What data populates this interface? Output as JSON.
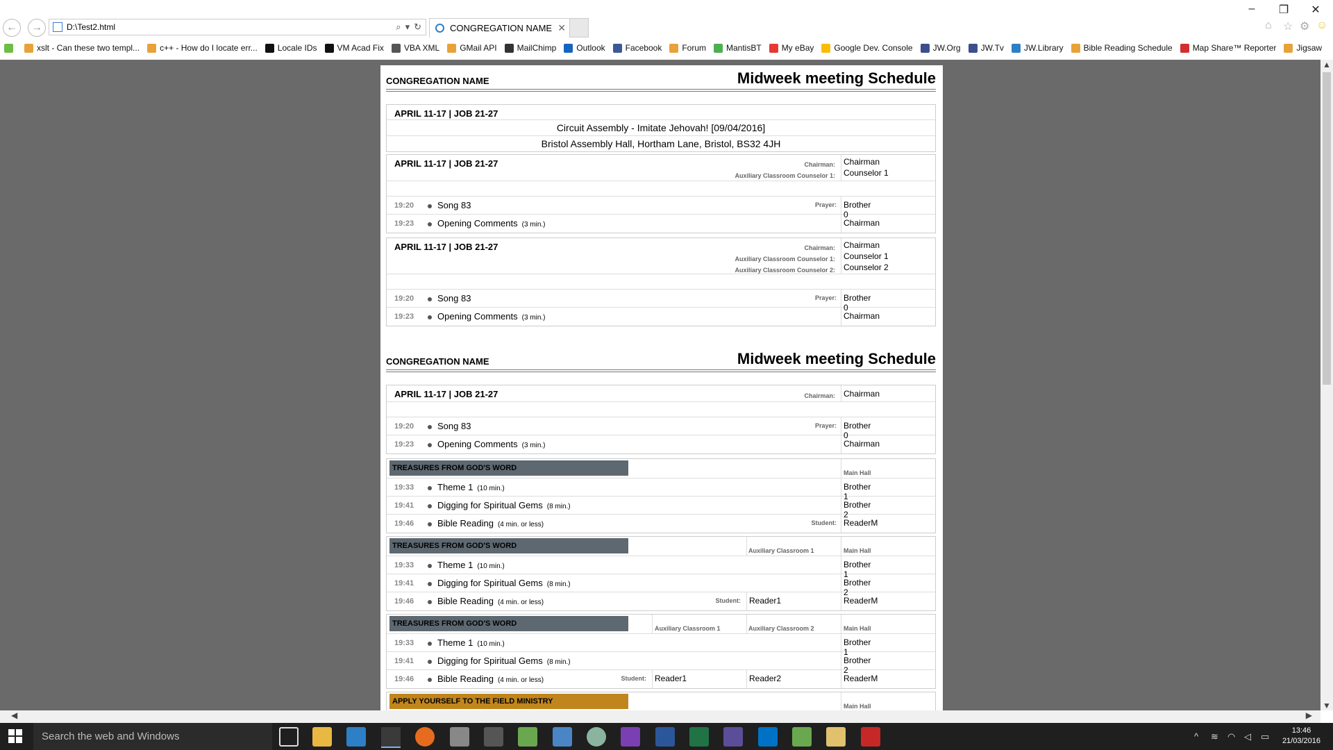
{
  "browser": {
    "address": "D:\\Test2.html",
    "tab_title": "CONGREGATION NAME",
    "tab_close": "✕",
    "favorites": [
      {
        "label": "xslt - Can these two templ...",
        "color": "#e8a23a"
      },
      {
        "label": "c++ - How do I locate err...",
        "color": "#e8a23a"
      },
      {
        "label": "Locale IDs",
        "color": "#111111"
      },
      {
        "label": "VM Acad Fix",
        "color": "#111111"
      },
      {
        "label": "VBA XML",
        "color": "#555555"
      },
      {
        "label": "GMail API",
        "color": "#e8a23a"
      },
      {
        "label": "MailChimp",
        "color": "#333333"
      },
      {
        "label": "Outlook",
        "color": "#1565c0"
      },
      {
        "label": "Facebook",
        "color": "#3b5998"
      },
      {
        "label": "Forum",
        "color": "#e8a23a"
      },
      {
        "label": "MantisBT",
        "color": "#4caf50"
      },
      {
        "label": "My eBay",
        "color": "#e53935"
      },
      {
        "label": "Google Dev. Console",
        "color": "#fbbc05"
      },
      {
        "label": "JW.Org",
        "color": "#3b4f8c"
      },
      {
        "label": "JW.Tv",
        "color": "#3b4f8c"
      },
      {
        "label": "JW.Library",
        "color": "#2d7fc6"
      },
      {
        "label": "Bible Reading Schedule",
        "color": "#e8a23a"
      },
      {
        "label": "Map Share™ Reporter",
        "color": "#d32f2f"
      },
      {
        "label": "Jigsaw",
        "color": "#e8a23a"
      }
    ]
  },
  "schedule": {
    "congregation": "CONGREGATION NAME",
    "title": "Midweek meeting Schedule",
    "week": "APRIL 11-17 | JOB 21-27",
    "assembly": "Circuit Assembly - Imitate Jehovah! [09/04/2016]",
    "venue": "Bristol Assembly Hall, Hortham Lane, Bristol, BS32 4JH",
    "roles": {
      "chairman": "Chairman:",
      "aux1": "Auxiliary Classroom Counselor 1:",
      "aux2": "Auxiliary Classroom Counselor 2:",
      "prayer": "Prayer:",
      "student": "Student:"
    },
    "names": {
      "chairman": "Chairman",
      "counselor1": "Counselor 1",
      "counselor2": "Counselor 2",
      "brother0": "Brother 0",
      "brother1": "Brother 1",
      "brother2": "Brother 2",
      "readerM": "ReaderM",
      "reader1": "Reader1",
      "reader2": "Reader2"
    },
    "times": {
      "t1": "19:20",
      "t2": "19:23",
      "t3": "19:33",
      "t4": "19:41",
      "t5": "19:46"
    },
    "items": {
      "song": "Song 83",
      "opening": "Opening Comments",
      "opening_dur": "(3 min.)",
      "theme": "Theme 1",
      "theme_dur": "(10 min.)",
      "gems": "Digging for Spiritual Gems",
      "gems_dur": "(8 min.)",
      "reading": "Bible Reading",
      "reading_dur": "(4 min. or less)"
    },
    "sections": {
      "treasures": "TREASURES FROM GOD'S WORD",
      "treasures_color": "#5d6870",
      "ministry": "APPLY YOURSELF TO THE FIELD MINISTRY",
      "ministry_color": "#c0861d"
    },
    "halls": {
      "main": "Main Hall",
      "aux1": "Auxiliary Classroom 1",
      "aux2": "Auxiliary Classroom 2"
    }
  },
  "taskbar": {
    "search_placeholder": "Search the web and Windows",
    "time": "13:46",
    "date": "21/03/2016"
  }
}
